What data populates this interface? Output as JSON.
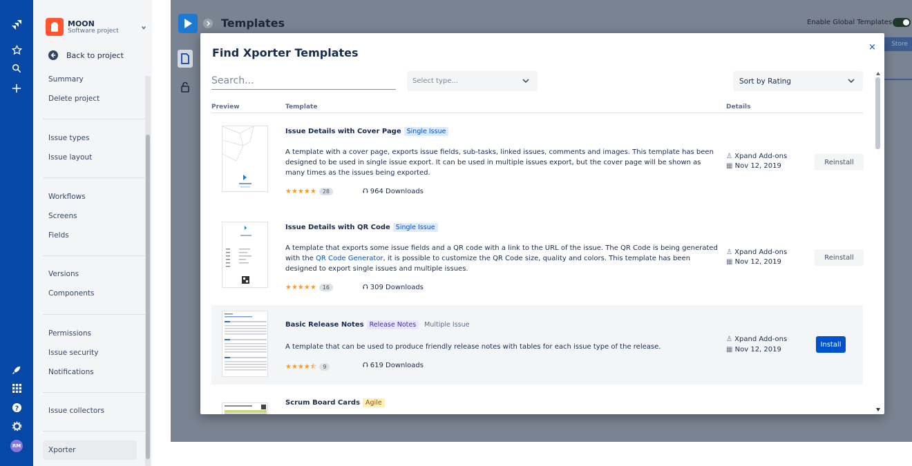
{
  "global_nav": {
    "icons": [
      "jira-logo-icon",
      "star-icon",
      "search-icon",
      "plus-icon",
      "rocket-icon",
      "app-switcher-icon",
      "help-icon",
      "settings-icon"
    ],
    "avatar_initials": "RM",
    "color": "#0747a6"
  },
  "sidebar": {
    "project_name": "MOON",
    "project_type": "Software project",
    "back_label": "Back to project",
    "groups": [
      [
        "Summary",
        "Delete project"
      ],
      [
        "Issue types",
        "Issue layout"
      ],
      [
        "Workflows",
        "Screens",
        "Fields"
      ],
      [
        "Versions",
        "Components"
      ],
      [
        "Permissions",
        "Issue security",
        "Notifications"
      ],
      [
        "Issue collectors"
      ],
      [
        "Xporter"
      ]
    ]
  },
  "header": {
    "title": "Templates",
    "global_templates_label": "Enable Global Templates",
    "store_label": "Store"
  },
  "modal": {
    "title": "Find Xporter Templates",
    "close": "×",
    "search_placeholder": "Search...",
    "type_placeholder": "Select type...",
    "sort_value": "Sort by Rating",
    "columns": {
      "preview": "Preview",
      "template": "Template",
      "details": "Details"
    },
    "templates": [
      {
        "name": "Issue Details with Cover Page",
        "tags": [
          {
            "label": "Single Issue",
            "style": "blue"
          }
        ],
        "desc": "A template with a cover page, exports issue fields, sub-tasks, linked issues, comments and images. This template has been designed to be used in single issue export. It can be used in multiple issues export, but the cover page will be shown as many times as the issues being exported.",
        "stars": "★★★★★",
        "rating_count": "28",
        "downloads": "964 Downloads",
        "author": "Xpand Add-ons",
        "date": "Nov 12, 2019",
        "action": "Reinstall"
      },
      {
        "name": "Issue Details with QR Code",
        "tags": [
          {
            "label": "Single Issue",
            "style": "blue"
          }
        ],
        "desc_a": "A template that exports some issue fields and a QR code with a link to the URL of the issue. The QR Code is being generated with the ",
        "desc_link": "QR Code Generator",
        "desc_b": ", it is possible to customize the QR Code size, quality and colors. This template has been designed to export single issues and multiple issues.",
        "stars": "★★★★★",
        "rating_count": "16",
        "downloads": "309 Downloads",
        "author": "Xpand Add-ons",
        "date": "Nov 12, 2019",
        "action": "Reinstall"
      },
      {
        "name": "Basic Release Notes",
        "tags": [
          {
            "label": "Release Notes",
            "style": "purple"
          },
          {
            "label": "Multiple Issue",
            "style": "gray"
          }
        ],
        "desc": "A template that can be used to produce friendly release notes with tables for each issue type of the release.",
        "stars": "★★★★⯪",
        "rating_count": "9",
        "downloads": "619 Downloads",
        "author": "Xpand Add-ons",
        "date": "Nov 12, 2019",
        "action": "Install"
      },
      {
        "name": "Scrum Board Cards",
        "tags": [
          {
            "label": "Agile",
            "style": "yellow"
          }
        ]
      }
    ]
  }
}
